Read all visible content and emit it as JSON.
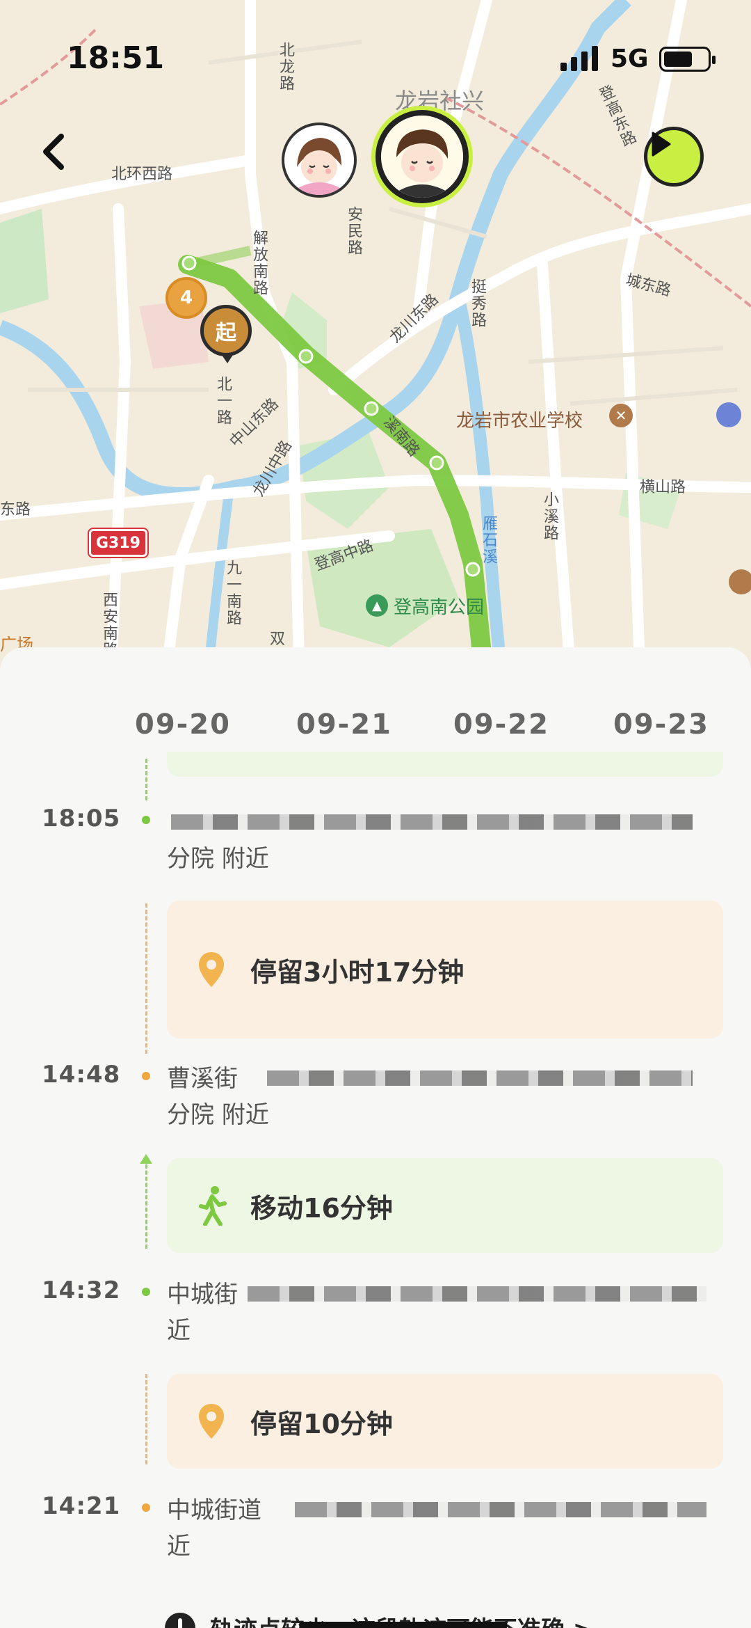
{
  "status_bar": {
    "time": "18:51",
    "network": "5G"
  },
  "map": {
    "labels": {
      "north_road": "北龙路",
      "district": "龙岩社兴",
      "beihuan_west": "北环西路",
      "dengao_east": "登高东路",
      "anmin": "安民路",
      "jiefang_south": "解放南路",
      "longchuan_east": "龙川东路",
      "tingxiu": "挺秀路",
      "chengdong": "城东路",
      "beiyi": "北一路",
      "zhongshan_east": "中山东路",
      "longchuan_middle": "龙川中路",
      "xinan": "溪南路",
      "school": "龙岩市农业学校",
      "hengshan": "横山路",
      "xiaoxi": "小溪路",
      "east_road": "东路",
      "yanshixi": "雁石溪",
      "dengao_middle": "登高中路",
      "jiuyi_south": "九一南路",
      "xian_south": "西安南路",
      "shuang": "双",
      "park": "登高南公园",
      "square": "广场"
    },
    "highway_badge": "G319",
    "marker_count": "4",
    "marker_start": "起"
  },
  "colors": {
    "route": "#7dc942",
    "accent": "#c9ef43",
    "stay": "#f0a742"
  },
  "dates": [
    "09-20",
    "09-21",
    "09-22",
    "09-23"
  ],
  "timeline": {
    "entry1": {
      "time": "18:05",
      "line2": "分院 附近"
    },
    "stay1": {
      "label": "停留3小时17分钟"
    },
    "entry2": {
      "time": "14:48",
      "prefix": "曹溪街",
      "line2": "分院 附近"
    },
    "move1": {
      "label": "移动16分钟"
    },
    "entry3": {
      "time": "14:32",
      "prefix": "中城街",
      "line2": "近"
    },
    "stay2": {
      "label": "停留10分钟"
    },
    "entry4": {
      "time": "14:21",
      "prefix": "中城街道",
      "line2": "近"
    }
  },
  "footer_note": "轨迹点较少，这段轨迹可能不准确 >"
}
